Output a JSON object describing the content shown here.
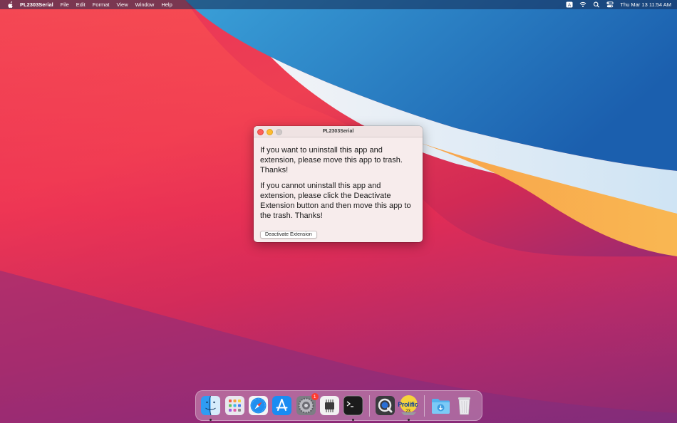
{
  "menubar": {
    "app_name": "PL2303Serial",
    "menus": [
      "File",
      "Edit",
      "Format",
      "View",
      "Window",
      "Help"
    ],
    "status_icons": [
      "keyboard-input-icon",
      "wifi-icon",
      "spotlight-search-icon",
      "control-center-icon"
    ],
    "input_source": "A",
    "clock": "Thu Mar 13  11:54 AM"
  },
  "window": {
    "title": "PL2303Serial",
    "message_1": "If you want to uninstall this app and extension, please move this app to trash. Thanks!",
    "message_2": "If you cannot uninstall this app and extension, please click the Deactivate Extension button and then move this app to the trash. Thanks!",
    "deactivate_button": "Deactivate Extension"
  },
  "dock": {
    "items": [
      {
        "name": "finder-icon",
        "running": true
      },
      {
        "name": "launchpad-icon",
        "running": false
      },
      {
        "name": "safari-icon",
        "running": false
      },
      {
        "name": "app-store-icon",
        "running": false
      },
      {
        "name": "system-preferences-icon",
        "running": false,
        "badge": "1"
      },
      {
        "name": "system-information-icon",
        "running": false
      },
      {
        "name": "terminal-icon",
        "running": true
      },
      {
        "name": "quicktime-icon",
        "running": false
      },
      {
        "name": "prolific-pl2303-icon",
        "running": true,
        "label": "Prolific",
        "sub_label": "23"
      },
      {
        "name": "downloads-folder-icon",
        "running": false
      },
      {
        "name": "trash-icon",
        "running": false
      }
    ]
  },
  "colors": {
    "close": "#fe5f57",
    "minimize": "#febc2e",
    "badge": "#fe3b30"
  }
}
